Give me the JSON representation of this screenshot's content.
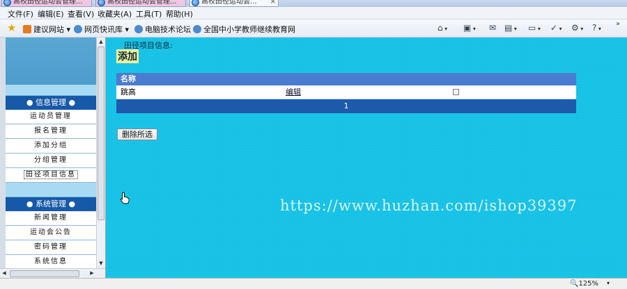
{
  "tabs": [
    {
      "title": "高校田径运动会管理...",
      "style": "pink"
    },
    {
      "title": "高校田径运动会管理...",
      "style": "pink"
    },
    {
      "title": "高校田径运动会...",
      "style": "active",
      "close": "×"
    }
  ],
  "menu": [
    "文件(F)",
    "编辑(E)",
    "查看(V)",
    "收藏夹(A)",
    "工具(T)",
    "帮助(H)"
  ],
  "favorites": [
    {
      "label": "建议网站 ▾",
      "icon": "suggested-sites-icon",
      "color": "#e67a1e"
    },
    {
      "label": "网页快讯库 ▾",
      "icon": "web-slice-icon",
      "color": "#4a8ad0"
    },
    {
      "label": "电脑技术论坛",
      "icon": "ie-page-icon",
      "color": "#4a8ad0"
    },
    {
      "label": "全国中小学教师继续教育网",
      "icon": "ie-page-icon",
      "color": "#4a8ad0"
    }
  ],
  "toolbar_icons": [
    "home-icon",
    "rss-feed-icon",
    "read-mail-icon",
    "print-icon",
    "page-menu-icon",
    "safety-icon",
    "tools-gear-icon",
    "help-icon"
  ],
  "sidebar": {
    "sections": [
      {
        "title": "● 信息管理 ●",
        "items": [
          "运动员管理",
          "报名管理",
          "添加分组",
          "分组管理",
          "田径项目信息"
        ]
      },
      {
        "title": "● 系统管理 ●",
        "items": [
          "新闻管理",
          "运动会公告",
          "密码管理",
          "系统信息"
        ]
      }
    ],
    "selected_item": "田径项目信息"
  },
  "main": {
    "info_label": "田径项目信息:",
    "add_link": "添加",
    "table": {
      "header": "名称",
      "rows": [
        {
          "name": "跳高",
          "action": "编辑",
          "checked": false
        }
      ],
      "pager": "1"
    },
    "delete_button": "删除所选",
    "watermark": "https://www.huzhan.com/ishop39397"
  },
  "status": {
    "zoom": "🔍125%",
    "zoom_arrow": "▾"
  }
}
